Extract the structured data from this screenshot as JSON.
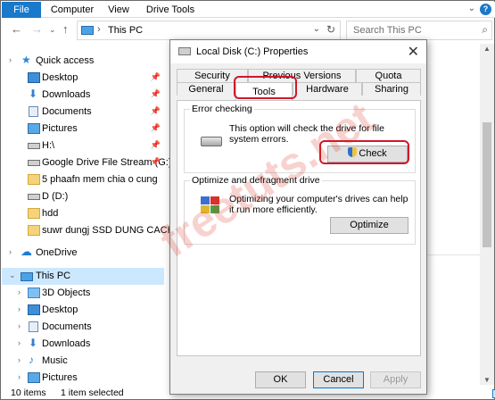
{
  "ribbon": {
    "tabs": [
      "File",
      "Computer",
      "View",
      "Drive Tools"
    ]
  },
  "address": {
    "path": "This PC",
    "search_placeholder": "Search This PC"
  },
  "sidebar": {
    "items": [
      {
        "label": "Quick access",
        "icon": "star-icon"
      },
      {
        "label": "Desktop",
        "icon": "desktop-icon",
        "pinned": true
      },
      {
        "label": "Downloads",
        "icon": "download-icon",
        "pinned": true
      },
      {
        "label": "Documents",
        "icon": "documents-icon",
        "pinned": true
      },
      {
        "label": "Pictures",
        "icon": "pictures-icon",
        "pinned": true
      },
      {
        "label": "H:\\",
        "icon": "drive-icon",
        "pinned": true
      },
      {
        "label": "Google Drive File Stream (G:)",
        "icon": "drive-icon",
        "pinned": true
      },
      {
        "label": "5 phaafn mem chia o cung",
        "icon": "folder-icon"
      },
      {
        "label": "D (D:)",
        "icon": "drive-icon"
      },
      {
        "label": "hdd",
        "icon": "folder-icon"
      },
      {
        "label": "suwr dungj SSD DUNG CACH",
        "icon": "folder-icon"
      },
      {
        "label": "OneDrive",
        "icon": "cloud-icon"
      },
      {
        "label": "This PC",
        "icon": "pc-icon",
        "selected": true
      },
      {
        "label": "3D Objects",
        "icon": "3d-objects-icon"
      },
      {
        "label": "Desktop",
        "icon": "desktop-icon"
      },
      {
        "label": "Documents",
        "icon": "documents-icon"
      },
      {
        "label": "Downloads",
        "icon": "download-icon"
      },
      {
        "label": "Music",
        "icon": "music-icon"
      },
      {
        "label": "Pictures",
        "icon": "pictures-icon"
      }
    ]
  },
  "status": {
    "items_count": "10 items",
    "selected": "1 item selected"
  },
  "dialog": {
    "title": "Local Disk (C:) Properties",
    "tabs_top": [
      "Security",
      "Previous Versions",
      "Quota"
    ],
    "tabs_bottom": [
      "General",
      "Tools",
      "Hardware",
      "Sharing"
    ],
    "active_tab": "Tools",
    "error_checking": {
      "heading": "Error checking",
      "description": "This option will check the drive for file system errors.",
      "button": "Check"
    },
    "optimize": {
      "heading": "Optimize and defragment drive",
      "description": "Optimizing your computer's drives can help it run more efficiently.",
      "button": "Optimize"
    },
    "buttons": {
      "ok": "OK",
      "cancel": "Cancel",
      "apply": "Apply"
    }
  },
  "watermark": "freetuts.net",
  "colors": {
    "accent": "#1979ca",
    "highlight": "#d0182a",
    "selection": "#cce8ff"
  }
}
